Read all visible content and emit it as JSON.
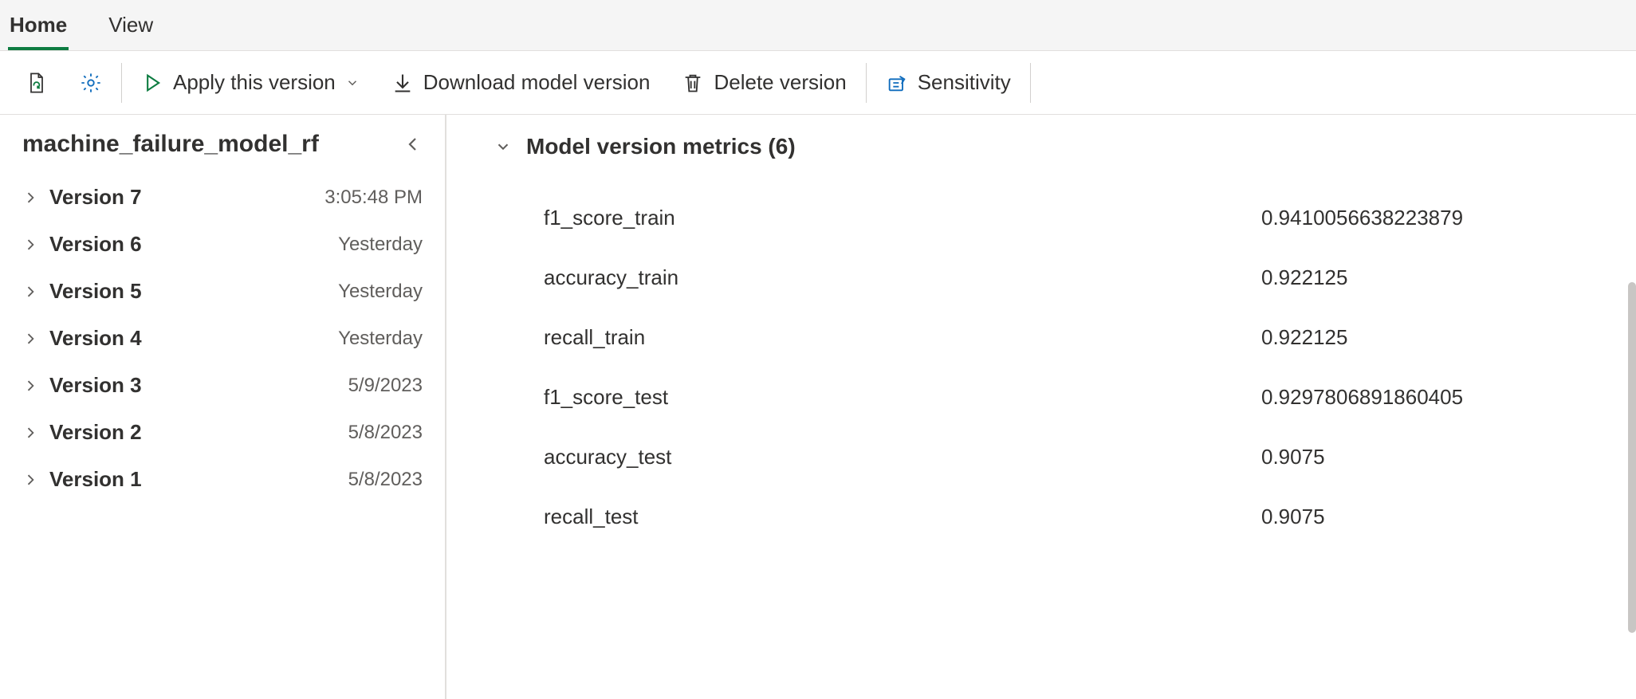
{
  "tabs": {
    "home": "Home",
    "view": "View"
  },
  "toolbar": {
    "apply": "Apply this version",
    "download": "Download model version",
    "delete": "Delete version",
    "sensitivity": "Sensitivity"
  },
  "sidebar": {
    "title": "machine_failure_model_rf",
    "versions": [
      {
        "name": "Version 7",
        "date": "3:05:48 PM"
      },
      {
        "name": "Version 6",
        "date": "Yesterday"
      },
      {
        "name": "Version 5",
        "date": "Yesterday"
      },
      {
        "name": "Version 4",
        "date": "Yesterday"
      },
      {
        "name": "Version 3",
        "date": "5/9/2023"
      },
      {
        "name": "Version 2",
        "date": "5/8/2023"
      },
      {
        "name": "Version 1",
        "date": "5/8/2023"
      }
    ]
  },
  "details": {
    "title": "Model version metrics (6)",
    "metrics": [
      {
        "name": "f1_score_train",
        "value": "0.9410056638223879"
      },
      {
        "name": "accuracy_train",
        "value": "0.922125"
      },
      {
        "name": "recall_train",
        "value": "0.922125"
      },
      {
        "name": "f1_score_test",
        "value": "0.9297806891860405"
      },
      {
        "name": "accuracy_test",
        "value": "0.9075"
      },
      {
        "name": "recall_test",
        "value": "0.9075"
      }
    ]
  }
}
